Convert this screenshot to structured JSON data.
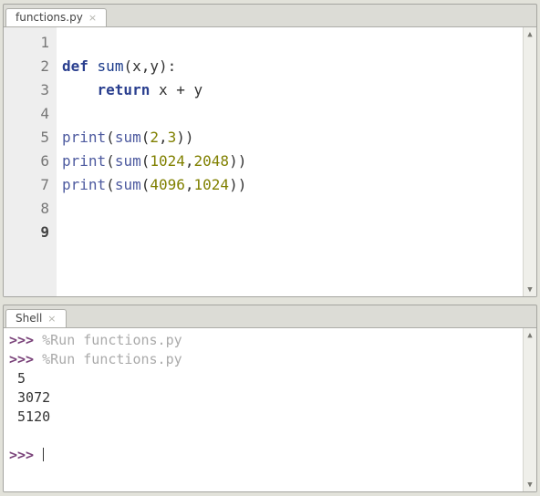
{
  "editor": {
    "tab_label": "functions.py",
    "lines": [
      "",
      "def sum(x,y):",
      "    return x + y",
      "",
      "print(sum(2,3))",
      "print(sum(1024,2048))",
      "print(sum(4096,1024))",
      "",
      ""
    ],
    "current_line": 9,
    "line_numbers": [
      "1",
      "2",
      "3",
      "4",
      "5",
      "6",
      "7",
      "8",
      "9"
    ]
  },
  "shell": {
    "tab_label": "Shell",
    "prompt": ">>>",
    "run1_cmd": "%Run functions.py",
    "run2_cmd": "%Run functions.py",
    "out1": " 5",
    "out2": " 3072",
    "out3": " 5120"
  }
}
